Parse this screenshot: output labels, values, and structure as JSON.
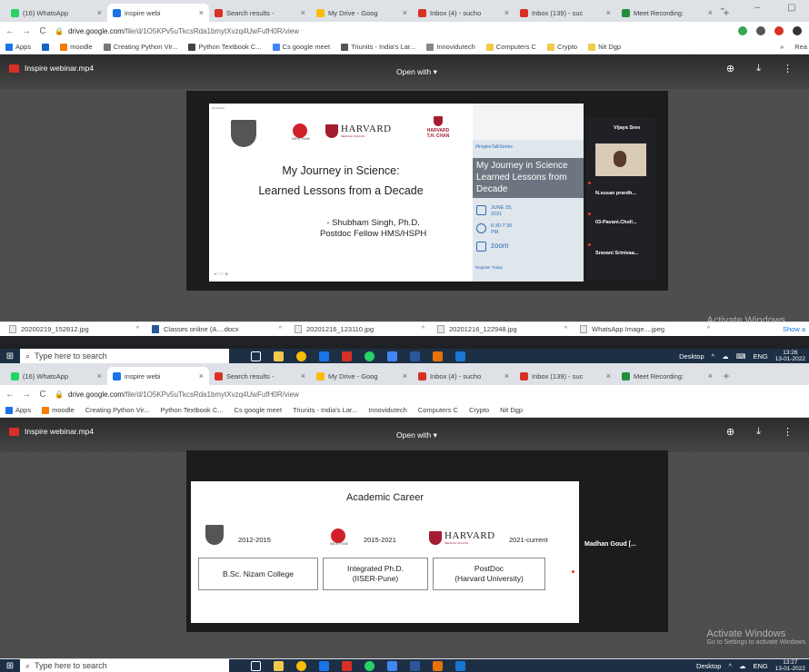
{
  "tabs": [
    {
      "label": "(16) WhatsApp",
      "close": "×",
      "color": "#25d366"
    },
    {
      "label": "inspire webi",
      "close": "×",
      "color": "#1a73e8",
      "active": true
    },
    {
      "label": "Search results -",
      "close": "×",
      "color": "#d93025"
    },
    {
      "label": "My Drive - Goog",
      "close": "×",
      "color": "#fbbc04"
    },
    {
      "label": "Inbox (4) - sucho",
      "close": "×",
      "color": "#d93025"
    },
    {
      "label": "Inbox (139) - suc",
      "close": "×",
      "color": "#d93025"
    },
    {
      "label": "Meet Recording:",
      "close": "×",
      "color": "#1e8e3e"
    }
  ],
  "newtab": "+",
  "url_host": "drive.google.com",
  "url_path": "/file/d/1O5KPv5uTkcsRda1bmytXvzq4UwFufH0R/view",
  "bookmarks": [
    "Apps",
    "moodle",
    "Creating Python Vir...",
    "Python Textbook C...",
    "Cs google meet",
    "Triunits - India's Lar...",
    "Innovidutech",
    "Computers C",
    "Crypto",
    "Nit Dgp"
  ],
  "bm_more": "»",
  "bm_read": "Rea",
  "file_name": "Inspire webinar.mp4",
  "open_with": "Open with ▾",
  "slide1": {
    "title_line1": "My Journey in Science:",
    "title_line2": "Learned Lessons from a Decade",
    "author_line1": "- Shubham Singh, Ph.D.",
    "author_line2": "Postdoc Fellow HMS/HSPH",
    "harvard": "HARVARD",
    "harvard_sub": "MEDICAL SCHOOL",
    "chan": "HARVARD\nT.H. CHAN",
    "iiser": "IISER PUNE"
  },
  "poster": {
    "tag": "#InspireTalkSeries",
    "headline": "My Journey in Science Learned Lessons from Decade",
    "date": "JUNE 25, 2021",
    "time": "6:30-7:30 PM",
    "zoom": "zoom",
    "register": "Register Today"
  },
  "meet1": {
    "names": [
      "Vijaya Sree",
      "N.susan prardh...",
      "03-Pavani.Choll...",
      "Sravani Srinivaa..."
    ]
  },
  "slide2": {
    "title": "Academic Career",
    "years": [
      "2012-2015",
      "2015-2021",
      "2021-current"
    ],
    "steps": [
      "B.Sc. Nizam College",
      "Integrated Ph.D.\n(IISER-Pune)",
      "PostDoc\n(Harvard University)"
    ]
  },
  "meet2": {
    "name": "Madhan Goud [..."
  },
  "watermark": {
    "title": "Activate Windows",
    "sub": "Go to Settings to activate Windows."
  },
  "downloads": [
    "20200219_152812.jpg",
    "Classes online (A....docx",
    "20201216_123110.jpg",
    "20201216_122948.jpg",
    "WhatsApp Image....jpeg"
  ],
  "show_all": "Show a",
  "taskbar": {
    "search": "Type here to search",
    "desktop": "Desktop",
    "lang": "ENG",
    "time1": "13:26",
    "time2": "13:27",
    "date": "13-01-2022"
  }
}
